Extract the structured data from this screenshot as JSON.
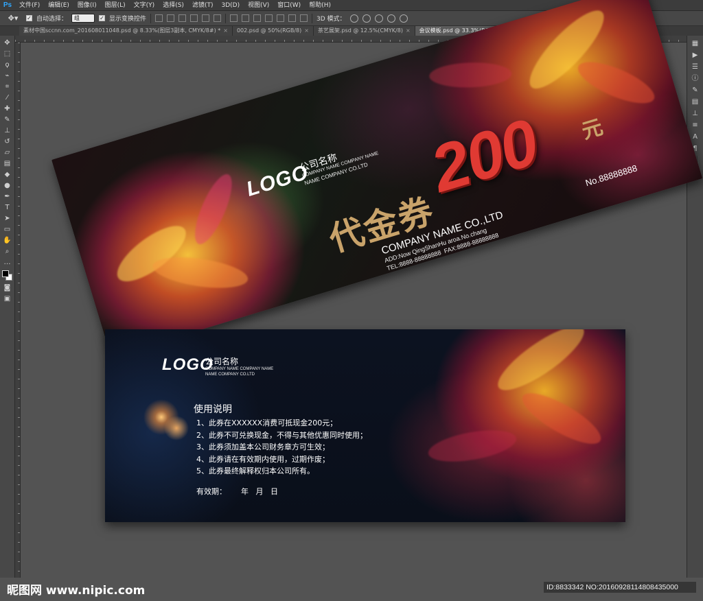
{
  "app": {
    "logo": "Ps"
  },
  "menu": {
    "items": [
      "文件(F)",
      "编辑(E)",
      "图像(I)",
      "图层(L)",
      "文字(Y)",
      "选择(S)",
      "滤镜(T)",
      "3D(D)",
      "视图(V)",
      "窗口(W)",
      "帮助(H)"
    ]
  },
  "options": {
    "auto_select_label": "自动选择：",
    "auto_select_value": "组",
    "show_transform_label": "显示变换控件",
    "mode_3d_label": "3D 模式："
  },
  "tabs": [
    {
      "label": "素材中国sccnn.com_201608011048.psd @ 8.33%(图层3副本, CMYK/8#) *",
      "active": false
    },
    {
      "label": "002.psd @ 50%(RGB/8)",
      "active": false
    },
    {
      "label": "茶艺展架.psd @ 12.5%(CMYK/8)",
      "active": false
    },
    {
      "label": "会议模板.psd @ 33.3%(RGB/8) *",
      "active": true
    }
  ],
  "voucher_front": {
    "logo": "LOGO",
    "company_cn": "公司名称",
    "company_en_line1": "COMPANY NAME COMPANY NAME",
    "company_en_line2": "NAME COMPANY CO.LTD",
    "title": "代金券",
    "amount": "200",
    "unit": "元",
    "serial": "No.88888888",
    "company_name": "COMPANY NAME CO.,LTD",
    "address": "ADD:Now QingShanHu aroa.No.chang",
    "tel_fax": "TEL:8888-88888888  FAX:8888-88888888"
  },
  "voucher_back": {
    "logo": "LOGO",
    "company_cn": "公司名称",
    "company_en_line1": "COMPANY NAME COMPANY NAME",
    "company_en_line2": "NAME COMPANY CO.LTD",
    "heading": "使用说明",
    "rules": [
      "1、此券在XXXXXX消费可抵现金200元；",
      "2、此券不可兑换现金，不得与其他优惠同时使用；",
      "3、此券须加盖本公司财务章方可生效；",
      "4、此券请在有效期内使用，过期作废；",
      "5、此券最终解释权归本公司所有。"
    ],
    "validity": "有效期：      年   月   日"
  },
  "watermark": {
    "site": "昵图网 www.nipic.com",
    "id_text": "ID:8833342 NO:20160928114808435000"
  },
  "colors": {
    "accent_red": "#e03a33",
    "gold": "#c9a36a",
    "ps_blue": "#31a8ff"
  }
}
